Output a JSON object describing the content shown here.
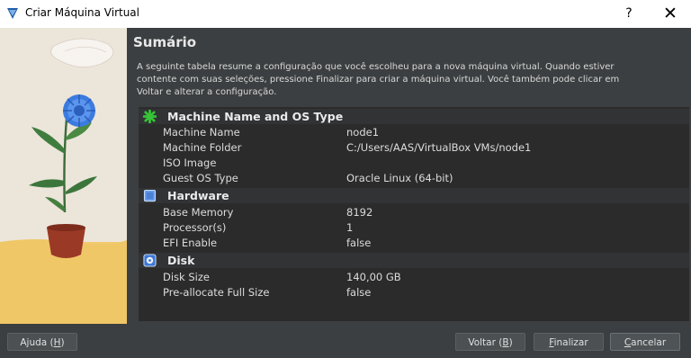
{
  "window": {
    "title": "Criar Máquina Virtual",
    "help_label": "?",
    "close_label": "✕"
  },
  "page": {
    "heading": "Sumário",
    "description": "A seguinte tabela resume a configuração que você escolheu para a nova máquina virtual. Quando estiver contente com suas seleções, pressione Finalizar para criar a máquina virtual. Você também pode clicar em Voltar e alterar a configuração."
  },
  "summary": {
    "sections": [
      {
        "title": "Machine Name and OS Type",
        "icon": "green-star-icon",
        "rows": [
          {
            "key": "Machine Name",
            "value": "node1"
          },
          {
            "key": "Machine Folder",
            "value": "C:/Users/AAS/VirtualBox VMs/node1"
          },
          {
            "key": "ISO Image",
            "value": ""
          },
          {
            "key": "Guest OS Type",
            "value": "Oracle Linux (64-bit)"
          }
        ]
      },
      {
        "title": "Hardware",
        "icon": "blue-chip-icon",
        "rows": [
          {
            "key": "Base Memory",
            "value": "8192"
          },
          {
            "key": "Processor(s)",
            "value": "1"
          },
          {
            "key": "EFI Enable",
            "value": "false"
          }
        ]
      },
      {
        "title": "Disk",
        "icon": "disk-icon",
        "rows": [
          {
            "key": "Disk Size",
            "value": "140,00 GB"
          },
          {
            "key": "Pre-allocate Full Size",
            "value": "false"
          }
        ]
      }
    ]
  },
  "buttons": {
    "help": {
      "label": "Ajuda (",
      "key": "H",
      "end": ")"
    },
    "back": {
      "label": "Voltar (",
      "key": "B",
      "end": ")"
    },
    "finish": {
      "label": "",
      "key": "F",
      "end": "inalizar"
    },
    "cancel": {
      "label": "",
      "key": "C",
      "end": "ancelar"
    }
  },
  "colors": {
    "background": "#3c3f41",
    "table_background": "#2b2b2b",
    "accent_green": "#37c437",
    "accent_blue": "#4a86e8"
  }
}
